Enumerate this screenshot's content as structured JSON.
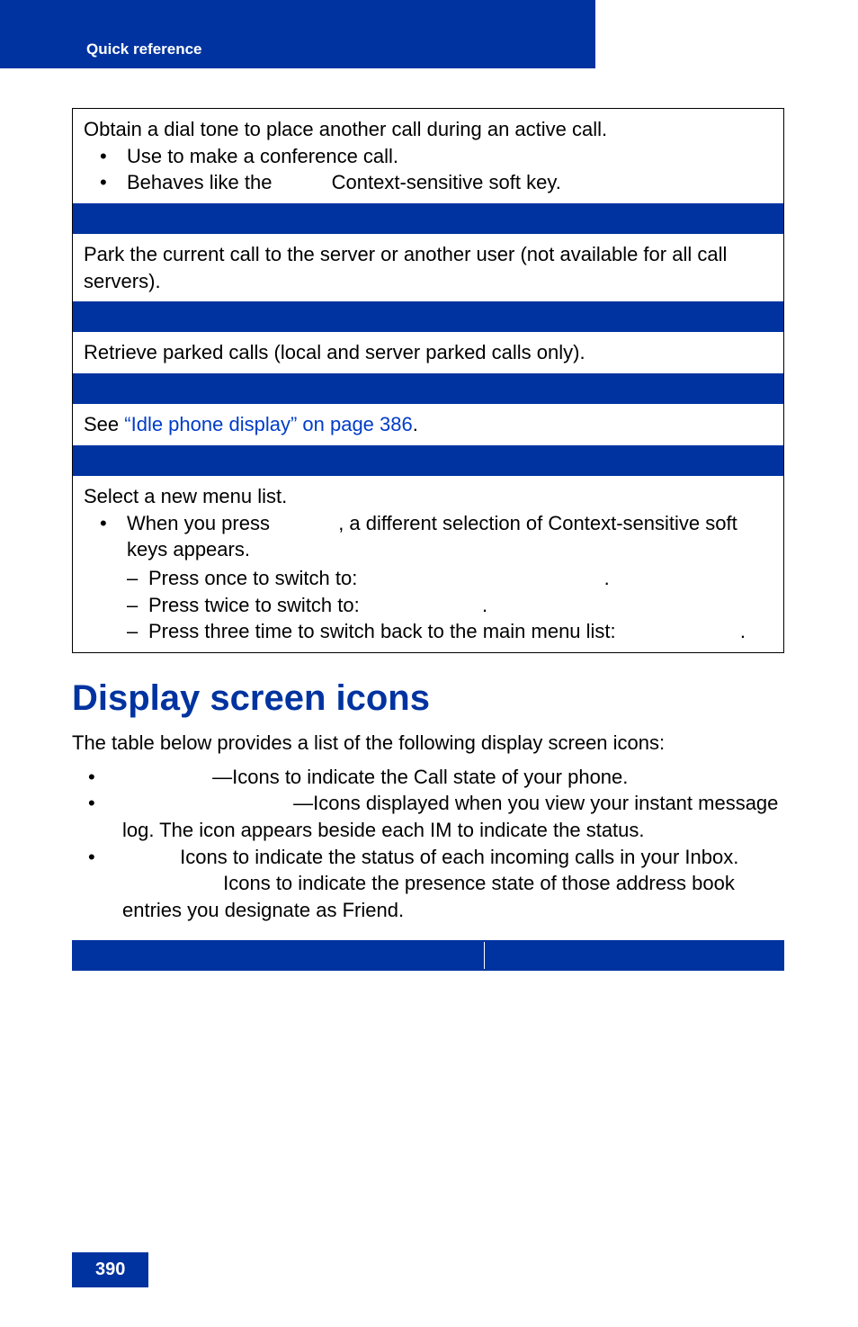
{
  "header": {
    "title": "Quick reference"
  },
  "table": {
    "row1": {
      "line1": "Obtain a dial tone to place another call during an active call.",
      "bullets": [
        {
          "text": "Use to make a conference call."
        },
        {
          "pre": "Behaves like the ",
          "post": " Context-sensitive soft key."
        }
      ]
    },
    "row2": {
      "text": "Park the current call to the server or another user (not available for all call servers)."
    },
    "row3": {
      "text": "Retrieve parked calls (local and server parked calls only)."
    },
    "row4": {
      "pre": "See ",
      "link": "“Idle phone display” on page 386",
      "post": "."
    },
    "row5": {
      "line1": "Select a new menu list.",
      "bullet": {
        "pre": "When you press ",
        "mid": ", a different selection of Context-sensitive soft keys appears."
      },
      "sub": [
        {
          "pre": "Press once to switch to: ",
          "post": "."
        },
        {
          "pre": "Press twice to switch to: ",
          "post": "."
        },
        {
          "pre": "Press three time to switch back to the main menu list: ",
          "post": "."
        }
      ]
    }
  },
  "section": {
    "title": "Display screen icons",
    "intro": "The table below provides a list of the following display screen icons:",
    "bullets": [
      {
        "text": "—Icons to indicate the Call state of your phone."
      },
      {
        "text": "—Icons displayed when you view your instant message log. The icon appears beside each IM to indicate the status."
      },
      {
        "text": " Icons to indicate the status of each incoming calls in your Inbox."
      }
    ],
    "tail": " Icons to indicate the presence state of those address book entries you designate as Friend."
  },
  "page_number": "390"
}
